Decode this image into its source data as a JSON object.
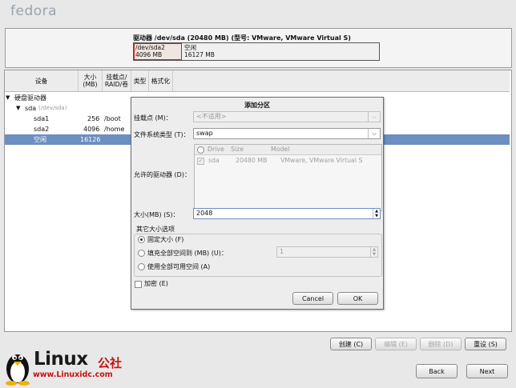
{
  "app": {
    "logo": "fedora"
  },
  "drive": {
    "title": "驱动器 /dev/sda (20480 MB) (型号: VMware, VMware Virtual S)",
    "seg1_line1": "/dev/sda2",
    "seg1_line2": "4096 MB",
    "seg2_line1": "空闲",
    "seg2_line2": "16127 MB"
  },
  "table": {
    "headers": [
      "设备",
      "大小\n(MB)",
      "挂载点/\nRAID/卷",
      "类型",
      "格式化"
    ],
    "rows": [
      {
        "device": "硬盘驱动器",
        "size": "",
        "mount": ""
      },
      {
        "device": "sda",
        "sub": "(/dev/sda)",
        "size": "",
        "mount": ""
      },
      {
        "device": "sda1",
        "size": "256",
        "mount": "/boot"
      },
      {
        "device": "sda2",
        "size": "4096",
        "mount": "/home"
      },
      {
        "device": "空闲",
        "size": "16126",
        "mount": ""
      }
    ]
  },
  "buttons": {
    "create": "创建 (C)",
    "edit": "编辑 (E)",
    "delete": "删除 (D)",
    "reset": "重设 (S)",
    "back": "Back",
    "next": "Next"
  },
  "watermark": {
    "brand": "Linux",
    "brand_cn": "公社",
    "url": "www.Linuxidc.com"
  },
  "dialog": {
    "title": "添加分区",
    "mount_label": "挂载点 (M)：",
    "mount_value": "<不适用>",
    "fstype_label": "文件系统类型 (T)：",
    "fstype_value": "swap",
    "drives_label": "允许的驱动器 (D)：",
    "drive_cols": [
      "Drive",
      "Size",
      "Model"
    ],
    "drive_row": {
      "drive": "sda",
      "size": "20480 MB",
      "model": "VMware, VMware Virtual S"
    },
    "size_label": "大小(MB) (S)：",
    "size_value": "2048",
    "other_options_label": "其它大小选项",
    "opt_fixed": "固定大小 (F)",
    "opt_fill_upto": "填充全部空间到 (MB) (U)：",
    "fill_upto_value": "1",
    "opt_fill_all": "使用全部可用空间 (A)",
    "encrypt_label": "加密 (E)",
    "cancel": "Cancel",
    "ok": "OK"
  }
}
